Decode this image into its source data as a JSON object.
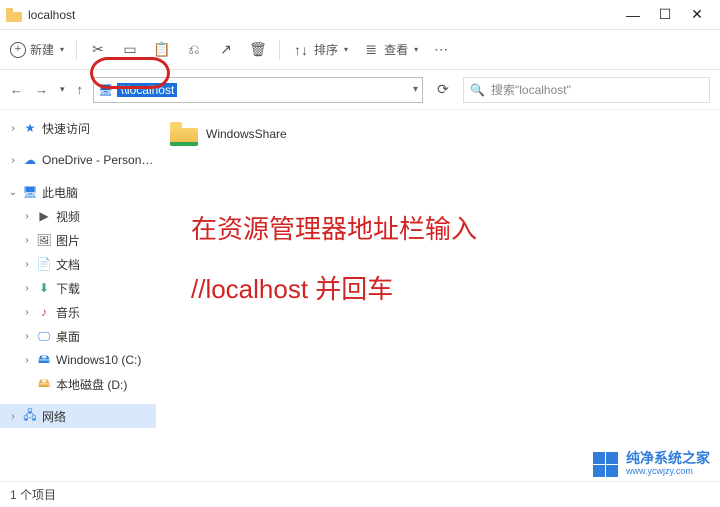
{
  "titlebar": {
    "title": "localhost"
  },
  "toolbar": {
    "new_label": "新建",
    "sort_label": "排序",
    "view_label": "查看"
  },
  "navbar": {
    "path_text": "\\\\localhost",
    "search_placeholder": "搜索\"localhost\""
  },
  "sidebar": {
    "quick_access": "快速访问",
    "onedrive": "OneDrive - Person…",
    "this_pc": "此电脑",
    "videos": "视频",
    "pictures": "图片",
    "documents": "文档",
    "downloads": "下载",
    "music": "音乐",
    "desktop": "桌面",
    "drive_c": "Windows10 (C:)",
    "drive_d": "本地磁盘 (D:)",
    "network": "网络"
  },
  "content": {
    "folder_name": "WindowsShare"
  },
  "overlay": {
    "line1": "在资源管理器地址栏输入",
    "line2": "//localhost   并回车"
  },
  "watermark": {
    "cn": "纯净系统之家",
    "url": "www.ycwjzy.com"
  },
  "statusbar": {
    "text": "1 个项目"
  }
}
